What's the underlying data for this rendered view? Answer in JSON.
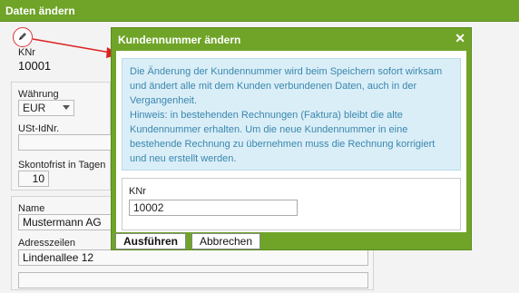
{
  "background": {
    "title": "Daten ändern",
    "knr_label": "KNr",
    "knr_value": "10001",
    "currency_label": "Währung",
    "currency_value": "EUR",
    "ust_label": "USt-IdNr.",
    "ust_value": "",
    "skonto_label": "Skontofrist in Tagen",
    "skonto_value": "10",
    "name_label": "Name",
    "name_value": "Mustermann AG",
    "address_label": "Adresszeilen",
    "address_line1": "Lindenallee 12",
    "address_line2": ""
  },
  "dialog": {
    "title": "Kundennummer ändern",
    "close": "✕",
    "info_text": "Die Änderung der Kundennummer wird beim Speichern sofort wirksam und ändert alle mit dem Kunden verbundenen Daten, auch in der Vergangenheit.",
    "hint_text": "Hinweis: in bestehenden Rechnungen (Faktura) bleibt die alte Kundennummer erhalten. Um die neue Kundennummer in eine bestehende Rechnung zu übernehmen muss die Rechnung korrigiert und neu erstellt werden.",
    "knr_label": "KNr",
    "knr_value": "10002",
    "execute_label": "Ausführen",
    "cancel_label": "Abbrechen"
  },
  "colors": {
    "titlebar": "#6fa428",
    "info_bg": "#daeef8",
    "info_text": "#3a87ad",
    "annotation": "#dd2222"
  }
}
